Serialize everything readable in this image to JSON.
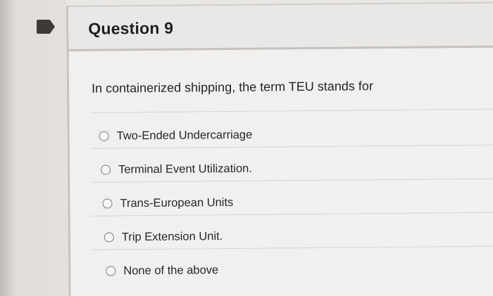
{
  "question": {
    "title": "Question 9",
    "prompt": "In containerized shipping, the term TEU stands for",
    "options": [
      {
        "label": "Two-Ended Undercarriage",
        "selected": false
      },
      {
        "label": "Terminal Event Utilization.",
        "selected": false
      },
      {
        "label": "Trans-European Units",
        "selected": false
      },
      {
        "label": "Trip Extension Unit.",
        "selected": false
      },
      {
        "label": "None of the above",
        "selected": false
      }
    ]
  },
  "colors": {
    "flag": "#3e3a36",
    "header_border": "#c4c1be",
    "card_background": "#f1f0ef"
  },
  "icons": {
    "flag": "bookmark-flag-icon",
    "radio": "radio-unchecked-icon"
  }
}
